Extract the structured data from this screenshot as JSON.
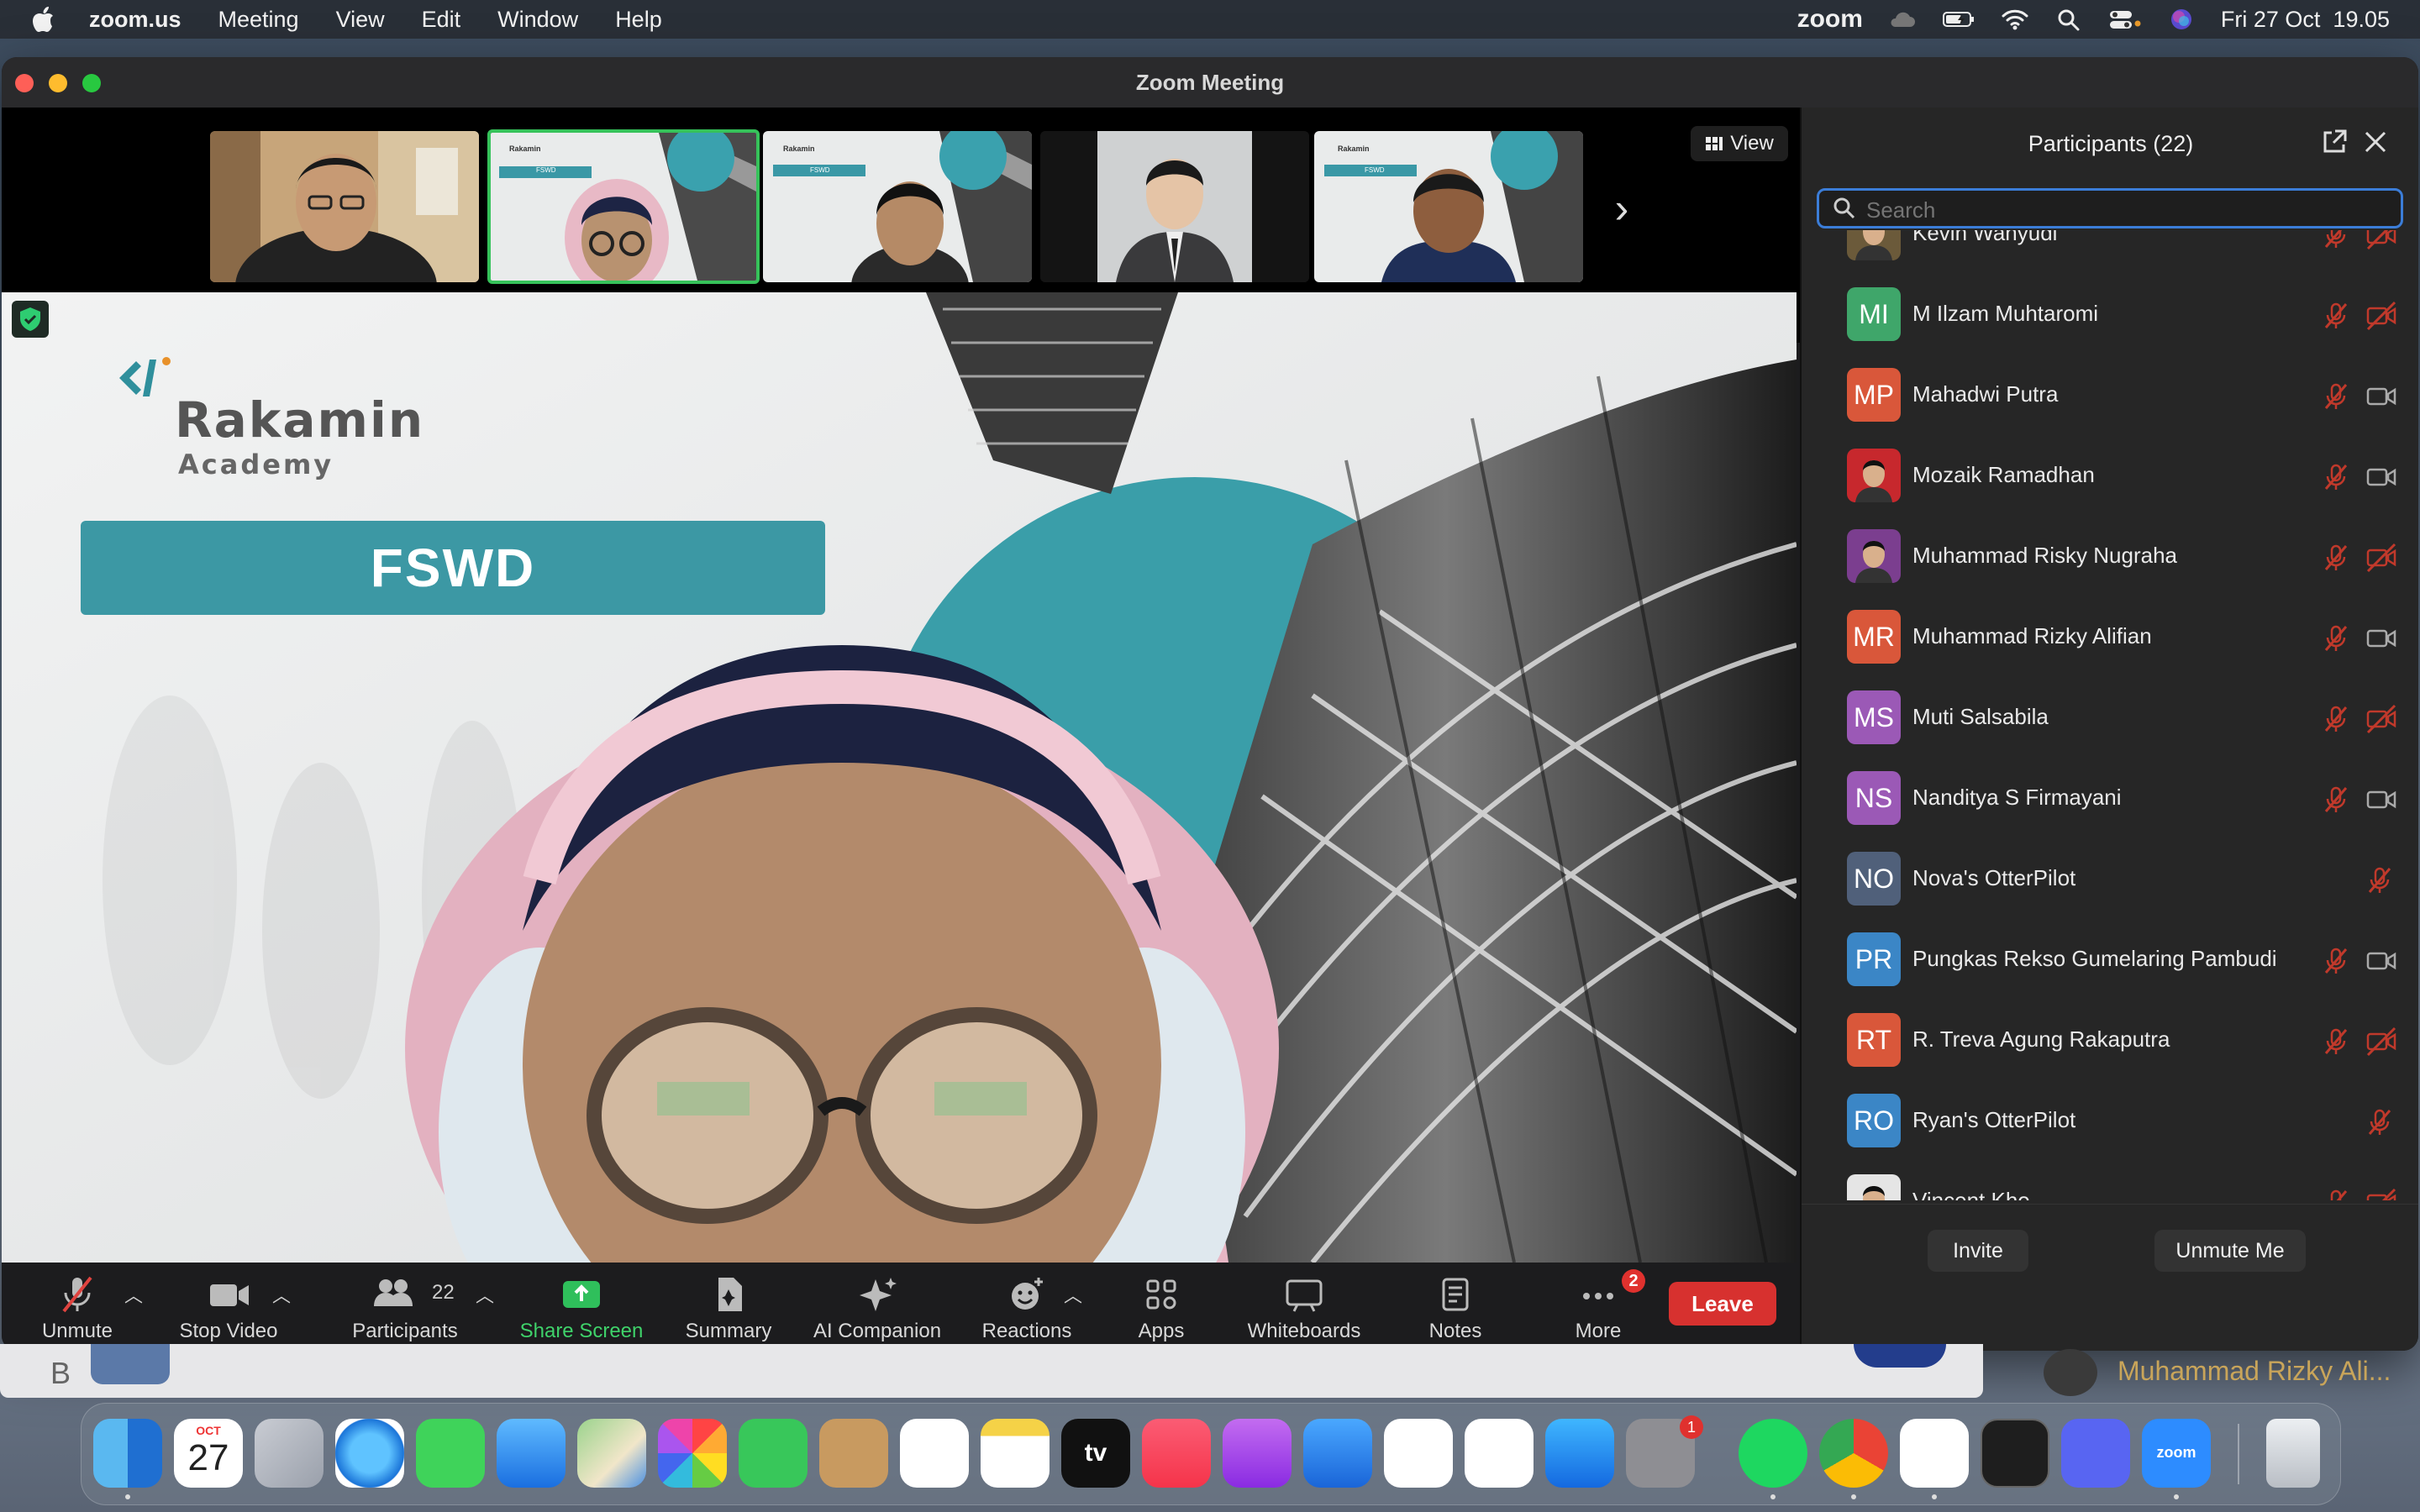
{
  "menubar": {
    "app_name": "zoom.us",
    "menus": [
      "Meeting",
      "View",
      "Edit",
      "Window",
      "Help"
    ],
    "zoom_status": "zoom",
    "datetime": "Fri 27 Oct  19.05"
  },
  "window": {
    "title": "Zoom Meeting",
    "view_label": "View"
  },
  "slide": {
    "brand_line1": "Rakamin",
    "brand_line2": "Academy",
    "banner": "FSWD"
  },
  "thumb_slide": {
    "brand": "Rakamin",
    "banner": "FSWD"
  },
  "toolbar": {
    "unmute": "Unmute",
    "stop_video": "Stop Video",
    "participants": "Participants",
    "participants_count": "22",
    "share_screen": "Share Screen",
    "summary": "Summary",
    "ai_companion": "AI Companion",
    "reactions": "Reactions",
    "apps": "Apps",
    "whiteboards": "Whiteboards",
    "notes": "Notes",
    "more": "More",
    "more_badge": "2",
    "leave": "Leave"
  },
  "panel": {
    "title": "Participants (22)",
    "search_placeholder": "Search",
    "invite": "Invite",
    "unmute_me": "Unmute Me",
    "participants": [
      {
        "name": "Kevin Wahyudi",
        "initials": "",
        "color": "#6b5a3a",
        "photo": true,
        "video": "off"
      },
      {
        "name": "M Ilzam Muhtaromi",
        "initials": "MI",
        "color": "#3fa66a",
        "photo": false,
        "video": "off"
      },
      {
        "name": "Mahadwi Putra",
        "initials": "MP",
        "color": "#d9573a",
        "photo": false,
        "video": "on"
      },
      {
        "name": "Mozaik Ramadhan",
        "initials": "",
        "color": "#c7282d",
        "photo": true,
        "video": "on"
      },
      {
        "name": "Muhammad Risky Nugraha",
        "initials": "",
        "color": "#7b3e8f",
        "photo": true,
        "video": "off"
      },
      {
        "name": "Muhammad Rizky Alifian",
        "initials": "MR",
        "color": "#d9573a",
        "photo": false,
        "video": "on"
      },
      {
        "name": "Muti Salsabila",
        "initials": "MS",
        "color": "#9b59b6",
        "photo": false,
        "video": "off"
      },
      {
        "name": "Nanditya S Firmayani",
        "initials": "NS",
        "color": "#9b59b6",
        "photo": false,
        "video": "on"
      },
      {
        "name": "Nova's OtterPilot",
        "initials": "NO",
        "color": "#50607a",
        "photo": false,
        "video": "none"
      },
      {
        "name": "Pungkas Rekso Gumelaring Pambudi",
        "initials": "PR",
        "color": "#3b86c6",
        "photo": false,
        "video": "on"
      },
      {
        "name": "R. Treva Agung Rakaputra",
        "initials": "RT",
        "color": "#d9573a",
        "photo": false,
        "video": "off"
      },
      {
        "name": "Ryan's OtterPilot",
        "initials": "RO",
        "color": "#3b86c6",
        "photo": false,
        "video": "none"
      },
      {
        "name": "Vincent Kho",
        "initials": "",
        "color": "#e5e5e5",
        "photo": true,
        "video": "off"
      }
    ]
  },
  "behind_window": {
    "letter": "B",
    "speaker_name": "Muhammad Rizky Ali..."
  },
  "dock": {
    "calendar_month": "OCT",
    "calendar_day": "27",
    "tv_label": "tv",
    "zoom_label": "zoom",
    "settings_badge": "1"
  }
}
